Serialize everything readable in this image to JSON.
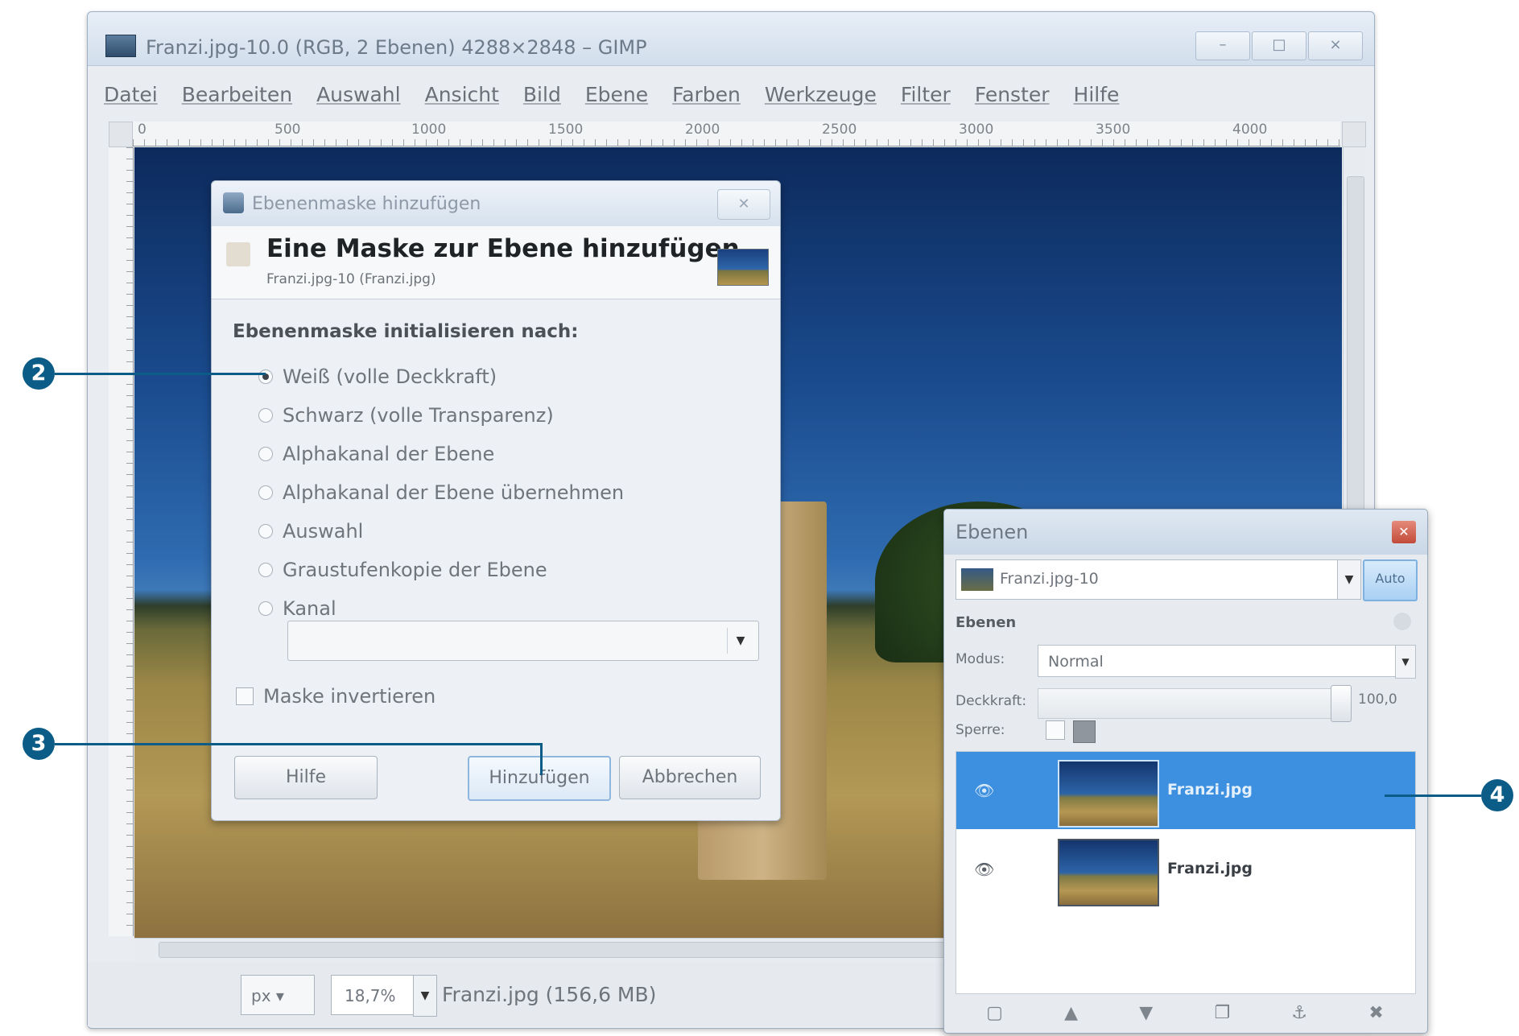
{
  "window": {
    "title": "Franzi.jpg-10.0 (RGB, 2 Ebenen) 4288×2848 – GIMP",
    "controls": [
      "–",
      "□",
      "×"
    ]
  },
  "menu": [
    "Datei",
    "Bearbeiten",
    "Auswahl",
    "Ansicht",
    "Bild",
    "Ebene",
    "Farben",
    "Werkzeuge",
    "Filter",
    "Fenster",
    "Hilfe"
  ],
  "ruler": {
    "ticks": [
      "0",
      "500",
      "1000",
      "1500",
      "2000",
      "2500",
      "3000",
      "3500",
      "4000"
    ]
  },
  "statusbar": {
    "unit": "px",
    "zoom": "18,7%",
    "file_info": "Franzi.jpg (156,6 MB)"
  },
  "dialog": {
    "window_title": "Ebenenmaske hinzufügen",
    "header_title": "Eine Maske zur Ebene hinzufügen",
    "header_subtitle": "Franzi.jpg-10 (Franzi.jpg)",
    "section_label": "Ebenenmaske initialisieren nach:",
    "options": [
      {
        "label": "Weiß (volle Deckkraft)",
        "selected": true
      },
      {
        "label": "Schwarz (volle Transparenz)",
        "selected": false
      },
      {
        "label": "Alphakanal der Ebene",
        "selected": false
      },
      {
        "label": "Alphakanal der Ebene übernehmen",
        "selected": false
      },
      {
        "label": "Auswahl",
        "selected": false
      },
      {
        "label": "Graustufenkopie der Ebene",
        "selected": false
      },
      {
        "label": "Kanal",
        "selected": false
      }
    ],
    "invert_label": "Maske invertieren",
    "invert_checked": false,
    "buttons": {
      "help": "Hilfe",
      "add": "Hinzufügen",
      "cancel": "Abbrechen"
    }
  },
  "layers_panel": {
    "title": "Ebenen",
    "image_select": "Franzi.jpg-10",
    "auto_label": "Auto",
    "tab_label": "Ebenen",
    "mode_label": "Modus:",
    "mode_value": "Normal",
    "opacity_label": "Deckkraft:",
    "opacity_value": "100,0",
    "opacity_percent": 100,
    "lock_label": "Sperre:",
    "layers": [
      {
        "name": "Franzi.jpg",
        "selected": true
      },
      {
        "name": "Franzi.jpg",
        "selected": false
      }
    ],
    "bottom_icons": [
      "new-layer-icon",
      "raise-icon",
      "lower-icon",
      "duplicate-icon",
      "anchor-icon",
      "delete-icon"
    ]
  },
  "callouts": [
    "2",
    "3",
    "4"
  ],
  "colors": {
    "callout": "#0b5c86",
    "selection": "#3d8fdf"
  }
}
